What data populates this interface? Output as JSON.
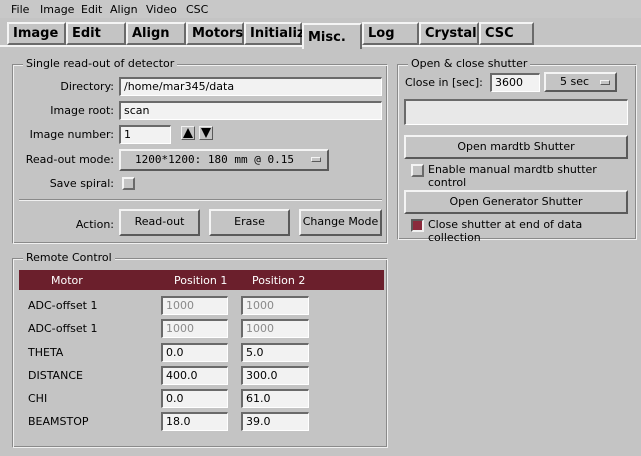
{
  "menubar": {
    "items": [
      "File",
      "Image",
      "Edit",
      "Align",
      "Video",
      "CSC"
    ]
  },
  "tabs": [
    "Image",
    "Edit",
    "Align",
    "Motors",
    "Initialize",
    "Misc.",
    "Log",
    "Crystal",
    "CSC"
  ],
  "active_tab": "Misc.",
  "readout": {
    "title": "Single read-out of detector",
    "directory_label": "Directory:",
    "directory_value": "/home/mar345/data",
    "image_root_label": "Image root:",
    "image_root_value": "scan",
    "image_number_label": "Image number:",
    "image_number_value": "1",
    "readout_mode_label": "Read-out mode:",
    "readout_mode_value": "1200*1200: 180 mm @ 0.15",
    "save_spiral_label": "Save spiral:",
    "action_label": "Action:",
    "readout_button": "Read-out",
    "erase_button": "Erase",
    "change_mode_button": "Change Mode"
  },
  "shutter": {
    "title": "Open & close shutter",
    "close_in_label": "Close in [sec]:",
    "close_in_value": "3600",
    "interval_value": "5 sec",
    "status_value": "",
    "open_mardtb_button": "Open mardtb Shutter",
    "enable_manual_label": "Enable manual mardtb shutter control",
    "open_generator_button": "Open  Generator Shutter",
    "close_at_end_label": "Close shutter at end of data collection",
    "colors": {
      "checked": "#8a2a3c"
    }
  },
  "remote": {
    "title": "Remote Control",
    "headers": [
      "Motor",
      "Position 1",
      "Position 2"
    ],
    "header_color": "#6b1f2c",
    "rows": [
      {
        "motor": "ADC-offset 1",
        "pos1": "1000",
        "pos2": "1000",
        "disabled": true
      },
      {
        "motor": "ADC-offset 1",
        "pos1": "1000",
        "pos2": "1000",
        "disabled": true
      },
      {
        "motor": "THETA",
        "pos1": "0.0",
        "pos2": "5.0",
        "disabled": false
      },
      {
        "motor": "DISTANCE",
        "pos1": "400.0",
        "pos2": "300.0",
        "disabled": false
      },
      {
        "motor": "CHI",
        "pos1": "0.0",
        "pos2": "61.0",
        "disabled": false
      },
      {
        "motor": "BEAMSTOP",
        "pos1": "18.0",
        "pos2": "39.0",
        "disabled": false
      }
    ]
  }
}
